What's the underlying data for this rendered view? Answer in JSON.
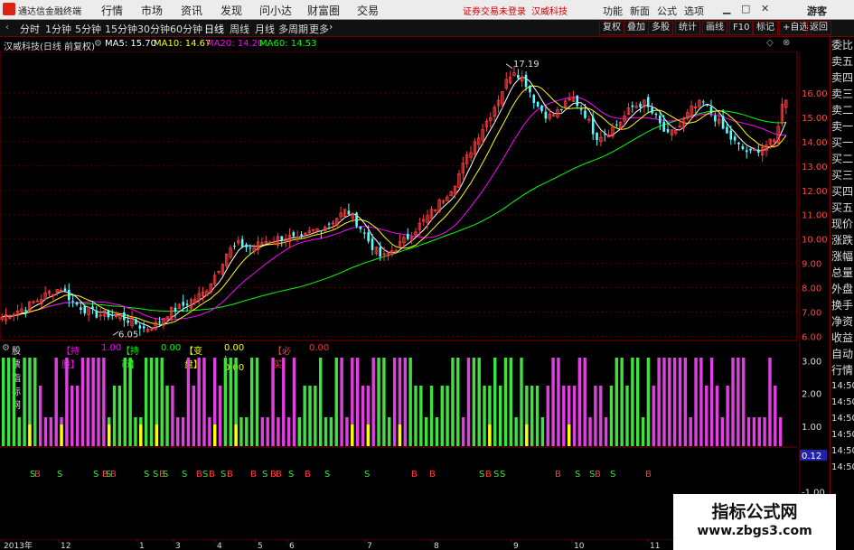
{
  "app": {
    "name": "通达信金融终端"
  },
  "menu": [
    "行情",
    "市场",
    "资讯",
    "发现",
    "问小达",
    "财富圈",
    "交易"
  ],
  "top_center": [
    "证券交易未登录",
    "汉威科技"
  ],
  "top_right": [
    "功能",
    "新面",
    "公式",
    "选项"
  ],
  "guest": "游客",
  "periods": [
    "分时",
    "1分钟",
    "5分钟",
    "15分钟",
    "30分钟",
    "60分钟",
    "日线",
    "周线",
    "月线",
    "多周期",
    "更多"
  ],
  "active_period": "日线",
  "right_buttons": [
    "复权",
    "叠加",
    "多股",
    "统计",
    "画线",
    "F10",
    "标记",
    "+自选",
    "返回"
  ],
  "info": {
    "stock": "汉威科技(日线 前复权)",
    "ma5": "MA5: 15.70",
    "ma10": "MA10: 14.67",
    "ma20": "MA20: 14.20",
    "ma60": "MA60: 14.53"
  },
  "price_labels": {
    "high": "17.19",
    "low": "6.05"
  },
  "price_axis": [
    "16.00",
    "15.00",
    "14.00",
    "13.00",
    "12.00",
    "11.00",
    "10.00",
    "9.00",
    "8.00",
    "7.00",
    "6.00"
  ],
  "ind_axis": [
    "3.00",
    "2.00",
    "1.00",
    "0.12",
    "-1.00"
  ],
  "sidebar": [
    "委比",
    "卖五",
    "卖四",
    "卖三",
    "卖二",
    "卖一",
    "买一",
    "买二",
    "买三",
    "买四",
    "买五",
    "现价",
    "涨跌",
    "涨幅",
    "总量",
    "外盘",
    "换手",
    "净资",
    "收益",
    "自动",
    "行情",
    "14:50",
    "14:50",
    "14:50",
    "14:50",
    "14:50",
    "14:50"
  ],
  "indicator": {
    "name": "股票指标网",
    "items": [
      {
        "label": "【持股】",
        "value": "1.00"
      },
      {
        "label": "【持币】",
        "value": "0.00"
      },
      {
        "label": "【变盘】",
        "value": "0.00 : 0.00"
      },
      {
        "label": "【必买】",
        "value": "0.00"
      }
    ]
  },
  "signals": "SBSSBSBSSBSSBSBSBBSBBSBSSBBSBSSBSSBSB",
  "dates": [
    "2013年",
    "12",
    "1",
    "3",
    "4",
    "5",
    "6",
    "7",
    "8",
    "9",
    "10",
    "11",
    "12"
  ],
  "watermark": [
    "指标公式网",
    "www.zbgs3.com"
  ],
  "colors": {
    "up": "#ff3c3c",
    "down": "#54ffff",
    "ma5": "#ffffff",
    "ma10": "#ffff00",
    "ma20": "#ff00ff",
    "ma60": "#00ff00",
    "hold_bar": "#e040e0",
    "cash_bar": "#40e040"
  },
  "chart_data": {
    "type": "candlestick",
    "price_ylim": [
      5.8,
      17.7
    ],
    "high": 17.19,
    "low": 6.05,
    "ma": {
      "MA5": 15.7,
      "MA10": 14.67,
      "MA20": 14.2,
      "MA60": 14.53
    },
    "close_path": [
      6.8,
      7.0,
      7.2,
      7.5,
      7.8,
      8.0,
      7.4,
      7.1,
      6.9,
      6.9,
      6.8,
      6.6,
      6.3,
      6.5,
      7.0,
      7.2,
      7.5,
      7.8,
      8.6,
      9.5,
      9.8,
      9.6,
      9.9,
      10.0,
      10.1,
      9.9,
      10.3,
      10.5,
      10.8,
      11.2,
      10.6,
      9.8,
      9.2,
      9.6,
      10.0,
      10.5,
      11.0,
      11.6,
      12.2,
      13.2,
      14.2,
      15.0,
      16.0,
      17.0,
      16.5,
      15.5,
      15.0,
      15.3,
      15.8,
      15.2,
      14.2,
      14.4,
      14.8,
      15.4,
      15.6,
      15.0,
      14.2,
      14.6,
      15.3,
      15.6,
      15.0,
      14.3,
      13.8,
      13.5,
      13.8,
      14.0,
      16.2
    ],
    "indicator_ylim": [
      -1.2,
      3.2
    ]
  }
}
